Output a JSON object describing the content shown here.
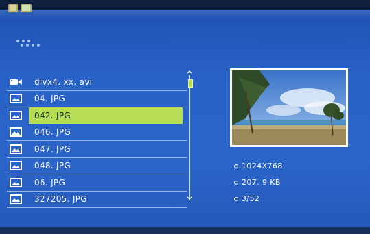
{
  "file_list": {
    "items": [
      {
        "label": "divx4. xx. avi",
        "icon": "video-camera-icon",
        "selected": false
      },
      {
        "label": "04. JPG",
        "icon": "photo-icon",
        "selected": false
      },
      {
        "label": "042. JPG",
        "icon": "photo-icon",
        "selected": true
      },
      {
        "label": "046. JPG",
        "icon": "photo-icon",
        "selected": false
      },
      {
        "label": "047. JPG",
        "icon": "photo-icon",
        "selected": false
      },
      {
        "label": "048. JPG",
        "icon": "photo-icon",
        "selected": false
      },
      {
        "label": "06. JPG",
        "icon": "photo-icon",
        "selected": false
      },
      {
        "label": "327205. JPG",
        "icon": "photo-icon",
        "selected": false
      }
    ]
  },
  "preview": {
    "resolution": "1024X768",
    "file_size": "207. 9 KB",
    "position": "3/52"
  },
  "colors": {
    "background": "#2a63c8",
    "highlight": "#b6dd53"
  },
  "top_icons": [
    "folder-icon",
    "photo-folder-icon"
  ]
}
